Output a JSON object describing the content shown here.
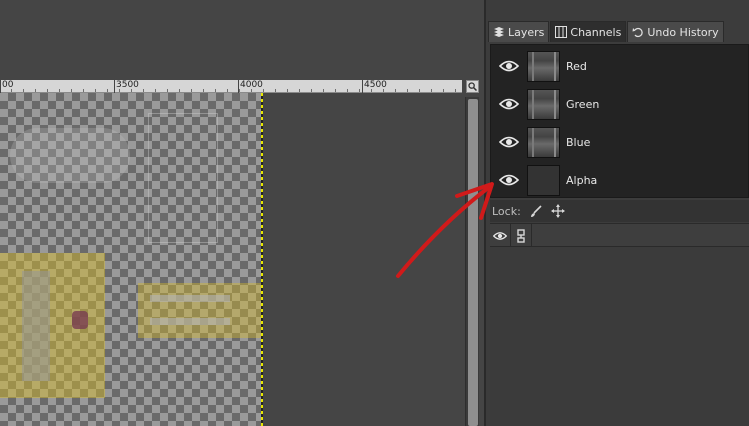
{
  "ruler": {
    "labels": [
      "00",
      "3500",
      "4000",
      "4500"
    ]
  },
  "dock": {
    "tabs": [
      {
        "label": "Layers",
        "icon": "layers-icon"
      },
      {
        "label": "Channels",
        "icon": "channels-icon"
      },
      {
        "label": "Undo History",
        "icon": "undo-history-icon"
      }
    ],
    "active_tab": "Channels",
    "channels": [
      {
        "name": "Red",
        "visible": true
      },
      {
        "name": "Green",
        "visible": true
      },
      {
        "name": "Blue",
        "visible": true
      },
      {
        "name": "Alpha",
        "visible": true
      }
    ],
    "lock_label": "Lock:"
  },
  "colors": {
    "annotation_arrow": "#d01a1a",
    "selection_edge": "#e6e600",
    "panel_bg": "#3c3c3c",
    "list_bg": "#232323"
  }
}
